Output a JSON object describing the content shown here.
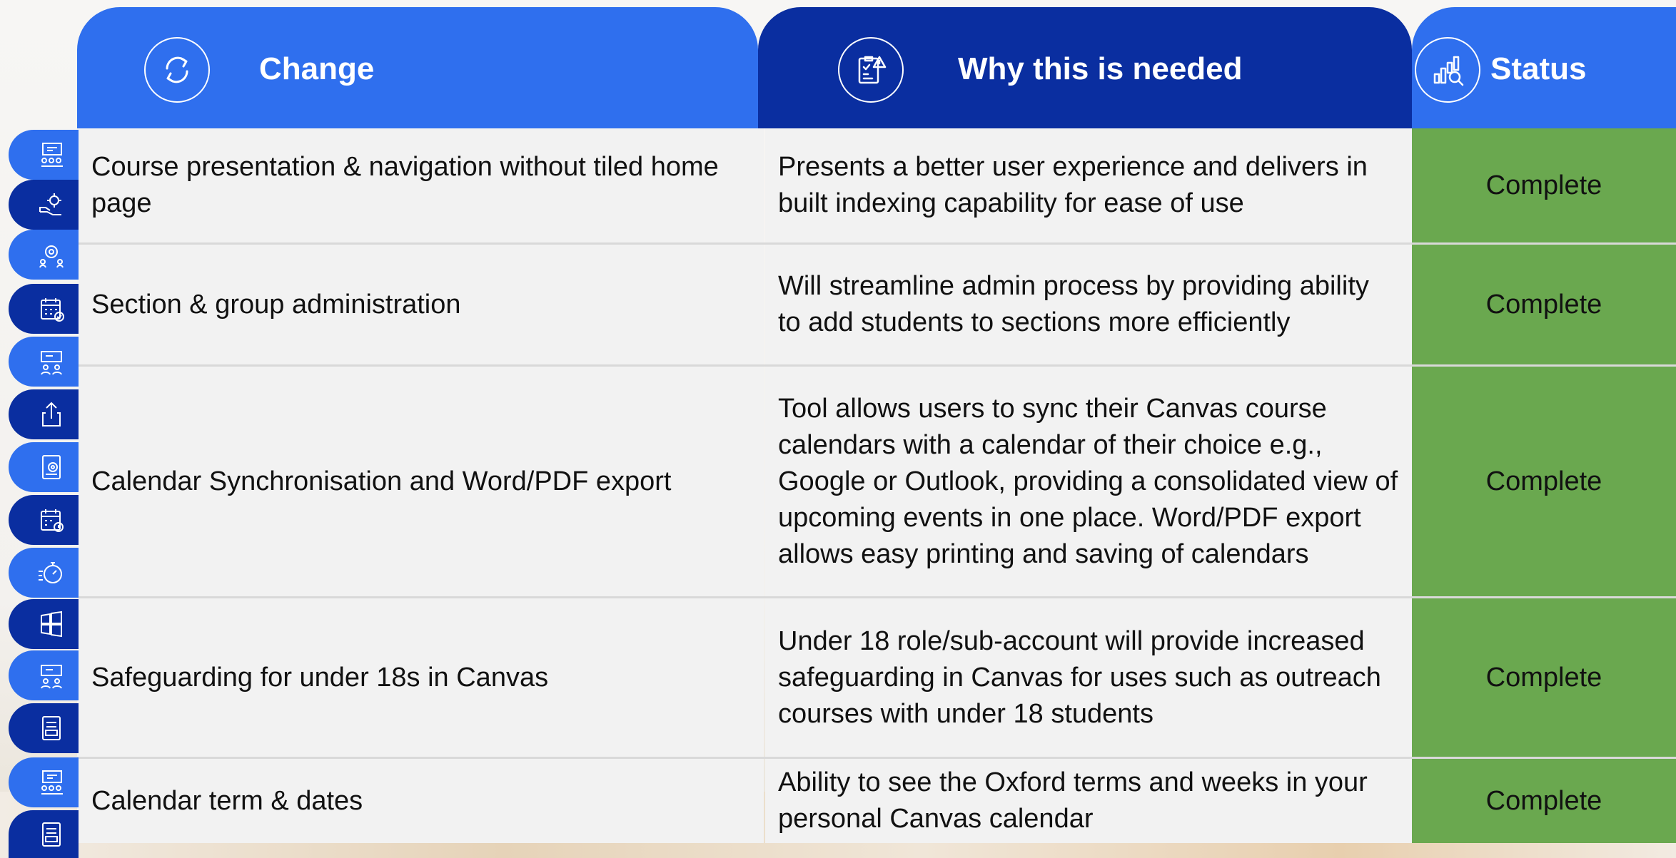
{
  "header": {
    "change": {
      "title": "Change",
      "icon": "sync-arrows-icon"
    },
    "why": {
      "title": "Why this is needed",
      "icon": "clipboard-alert-icon"
    },
    "status": {
      "title": "Status",
      "icon": "bar-chart-search-icon"
    }
  },
  "rows": [
    {
      "change": "Course presentation & navigation without tiled home page",
      "why": "Presents a better user experience and delivers in built indexing capability for ease of use",
      "status": "Complete"
    },
    {
      "change": "Section & group administration",
      "why": "Will streamline admin process by providing ability to add students to sections more efficiently",
      "status": "Complete"
    },
    {
      "change": "Calendar Synchronisation and Word/PDF export",
      "why": "Tool allows users to sync their Canvas course calendars with a calendar of their choice e.g., Google or Outlook, providing a consolidated view of upcoming events in one place. Word/PDF export allows easy printing and saving of calendars",
      "status": "Complete"
    },
    {
      "change": "Safeguarding for under 18s in Canvas",
      "why": "Under 18 role/sub-account will provide increased safeguarding in Canvas for uses such as outreach courses with under 18 students",
      "status": "Complete"
    },
    {
      "change": "Calendar term & dates",
      "why": "Ability to see the Oxford terms and weeks in your personal Canvas calendar",
      "status": "Complete"
    }
  ],
  "rail_icons": [
    "presentation-board-icon",
    "hand-gear-icon",
    "team-gear-icon",
    "calendar-check-icon",
    "presentation-people-icon",
    "share-upload-icon",
    "document-settings-icon",
    "calendar-clock-icon",
    "stopwatch-icon",
    "windows-grid-icon",
    "presentation-people-icon",
    "document-list-icon",
    "presentation-board-icon",
    "document-list-icon"
  ],
  "colors": {
    "blue": "#2f6fee",
    "navy": "#0a2ea0",
    "status_green": "#6aa84f",
    "cell_grey": "#f2f2f2"
  }
}
